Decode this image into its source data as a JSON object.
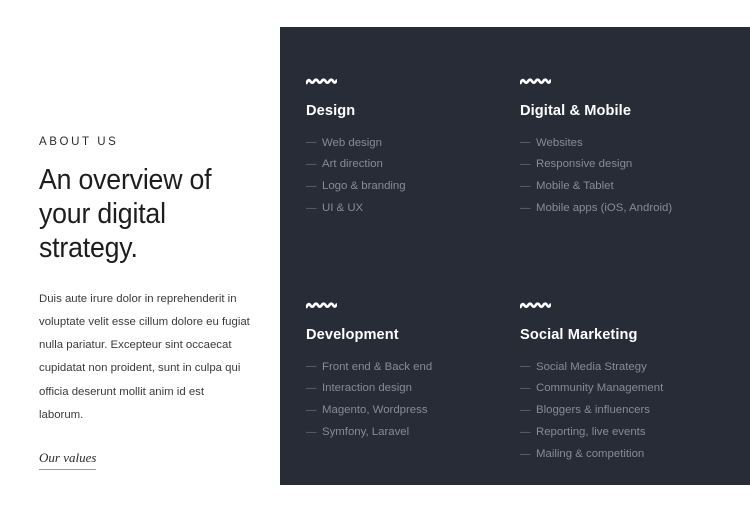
{
  "colors": {
    "page_background": "#ffffff",
    "panel_background": "#282c36",
    "heading_text": "#1d1d1d",
    "body_text": "#3a3a3a",
    "panel_title": "#ffffff",
    "panel_list_text": "#868b97",
    "panel_dash": "#6b7080",
    "link_underline": "#9a9a9a"
  },
  "left": {
    "eyebrow": "ABOUT US",
    "headline": "An overview of your digital strategy.",
    "body": "Duis aute irure dolor in reprehenderit in voluptate velit esse cillum dolore eu fugiat nulla pariatur. Excepteur sint occaecat cupidatat non proident, sunt in culpa qui officia deserunt mollit anim id est laborum.",
    "link_label": "Our values"
  },
  "panel": {
    "icon_name": "wavy-squiggle-icon",
    "cells": [
      {
        "title": "Design",
        "items": [
          "Web design",
          "Art direction",
          "Logo & branding",
          "UI & UX"
        ]
      },
      {
        "title": "Digital & Mobile",
        "items": [
          "Websites",
          "Responsive design",
          "Mobile & Tablet",
          "Mobile apps (iOS, Android)"
        ]
      },
      {
        "title": "Development",
        "items": [
          "Front end & Back end",
          "Interaction design",
          "Magento, Wordpress",
          "Symfony, Laravel"
        ]
      },
      {
        "title": "Social Marketing",
        "items": [
          "Social Media Strategy",
          "Community Management",
          "Bloggers & influencers",
          "Reporting, live events",
          "Mailing & competition"
        ]
      }
    ]
  }
}
